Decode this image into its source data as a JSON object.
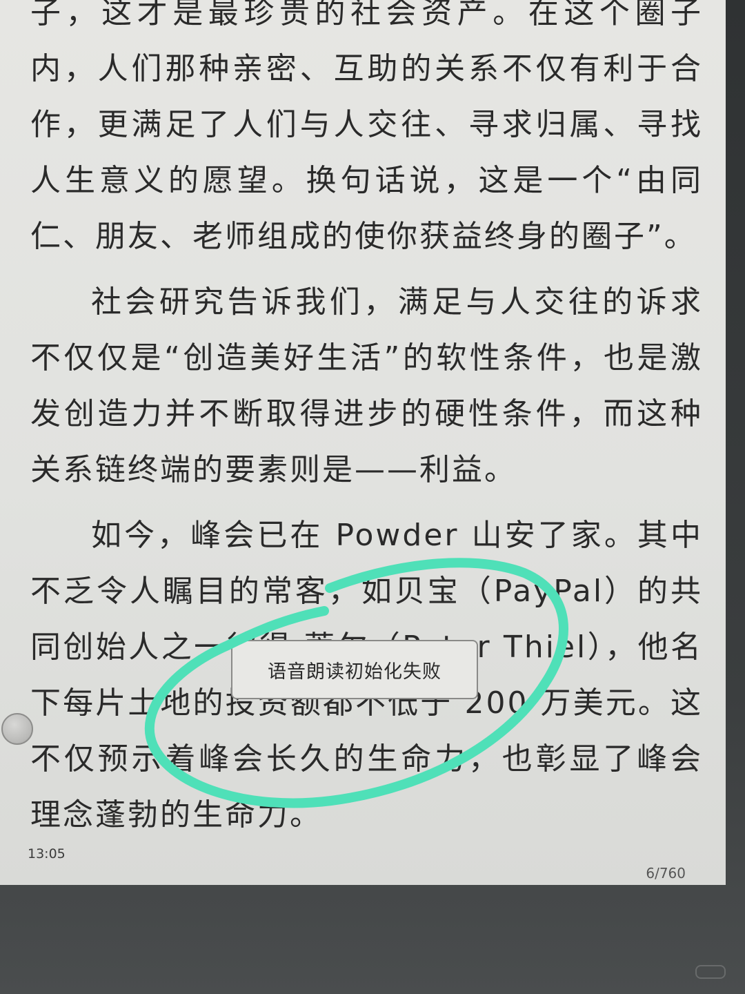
{
  "reader": {
    "paragraphs": [
      "子，这才是最珍贵的社会资产。在这个圈子内，人们那种亲密、互助的关系不仅有利于合作，更满足了人们与人交往、寻求归属、寻找人生意义的愿望。换句话说，这是一个“由同仁、朋友、老师组成的使你获益终身的圈子”。",
      "社会研究告诉我们，满足与人交往的诉求不仅仅是“创造美好生活”的软性条件，也是激发创造力并不断取得进步的硬性条件，而这种关系链终端的要素则是——利益。",
      "如今，峰会已在 Powder 山安了家。其中不乏令人瞩目的常客，如贝宝（PayPal）的共同创始人之一彼得·蒂尔（Peter Thiel），他名下每片土地的投资额都不低于 200 万美元。这不仅预示着峰会长久的生命力，也彰显了峰会理念蓬勃的生命力。"
    ]
  },
  "status_bar": {
    "time": "13:05",
    "page_counter": "6/760"
  },
  "toast": {
    "message": "语音朗读初始化失败"
  },
  "annotation": {
    "stroke_color": "#4fe0b8"
  }
}
